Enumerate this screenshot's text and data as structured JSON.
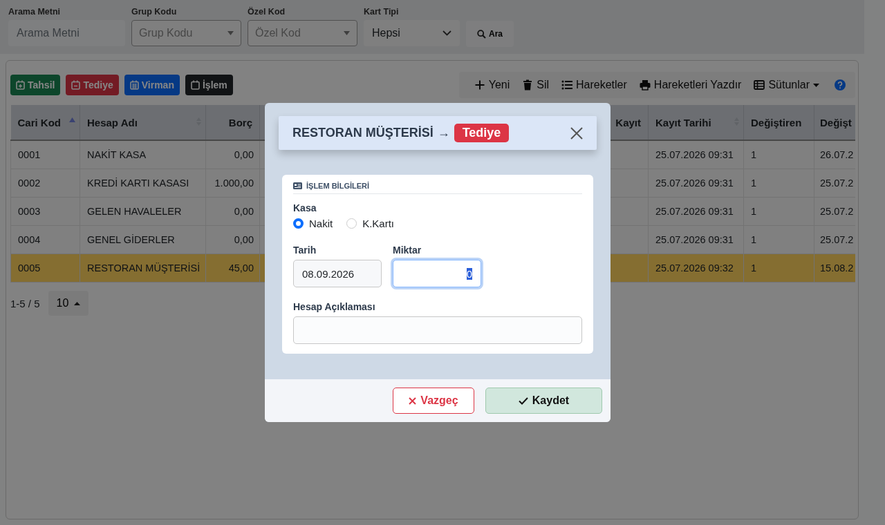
{
  "filters": [
    {
      "label": "Arama Metni",
      "placeholder": "Arama Metni",
      "kind": "text"
    },
    {
      "label": "Grup Kodu",
      "placeholder": "Grup Kodu",
      "kind": "combo"
    },
    {
      "label": "Özel Kod",
      "placeholder": "Özel Kod",
      "kind": "combo"
    },
    {
      "label": "Kart Tipi",
      "value": "Hepsi",
      "kind": "select"
    }
  ],
  "search_button": "Ara",
  "action_buttons": [
    {
      "label": "Tahsil",
      "kind": "success"
    },
    {
      "label": "Tediye",
      "kind": "danger"
    },
    {
      "label": "Virman",
      "kind": "primary"
    },
    {
      "label": "İşlem",
      "kind": "dark"
    }
  ],
  "toolbar": [
    {
      "label": "Yeni",
      "dropdown": false
    },
    {
      "label": "Sil",
      "dropdown": false
    },
    {
      "label": "Hareketler",
      "dropdown": false
    },
    {
      "label": "Hareketleri Yazdır",
      "dropdown": false
    },
    {
      "label": "Sütunlar",
      "dropdown": true
    }
  ],
  "table": {
    "columns": [
      {
        "label": "Cari Kod",
        "sorted": true
      },
      {
        "label": "Hesap Adı",
        "sorted": false
      },
      {
        "label": "Borç"
      },
      {
        "label": "Kayıt"
      },
      {
        "label": "Kayıt Tarihi",
        "sorted": false
      },
      {
        "label": "Değiştiren"
      },
      {
        "label": "Değişt"
      }
    ],
    "rows": [
      {
        "code": "0001",
        "name": "NAKİT KASA",
        "debt": "0,00",
        "created": "25.07.2026 09:31",
        "changed_by": "1",
        "changed_at": "26.07.2",
        "selected": false
      },
      {
        "code": "0002",
        "name": "KREDİ KARTI KASASI",
        "debt": "1.000,00",
        "created": "25.07.2026 09:31",
        "changed_by": "1",
        "changed_at": "25.07.2",
        "selected": false
      },
      {
        "code": "0003",
        "name": "GELEN HAVALELER",
        "debt": "0,00",
        "created": "25.07.2026 09:31",
        "changed_by": "1",
        "changed_at": "25.07.2",
        "selected": false
      },
      {
        "code": "0004",
        "name": "GENEL GİDERLER",
        "debt": "0,00",
        "created": "25.07.2026 09:31",
        "changed_by": "1",
        "changed_at": "25.07.2",
        "selected": false
      },
      {
        "code": "0005",
        "name": "RESTORAN MÜŞTERİSİ",
        "debt": "45,00",
        "created": "25.07.2026 09:32",
        "changed_by": "1",
        "changed_at": "15.08.2",
        "selected": true
      }
    ]
  },
  "pagination": {
    "range": "1-5 / 5",
    "page_size": "10"
  },
  "modal": {
    "title": "RESTORAN MÜŞTERİSİ",
    "arrow": "→",
    "badge": "Tediye",
    "section": "İŞLEM BİLGİLERİ",
    "kasa_label": "Kasa",
    "options": [
      {
        "label": "Nakit",
        "selected": true
      },
      {
        "label": "K.Kartı",
        "selected": false
      }
    ],
    "date_label": "Tarih",
    "date_value": "08.09.2026",
    "amount_label": "Miktar",
    "amount_value": "0",
    "amount_focused": true,
    "description_label": "Hesap Açıklaması",
    "cancel": "Vazgeç",
    "save": "Kaydet"
  }
}
